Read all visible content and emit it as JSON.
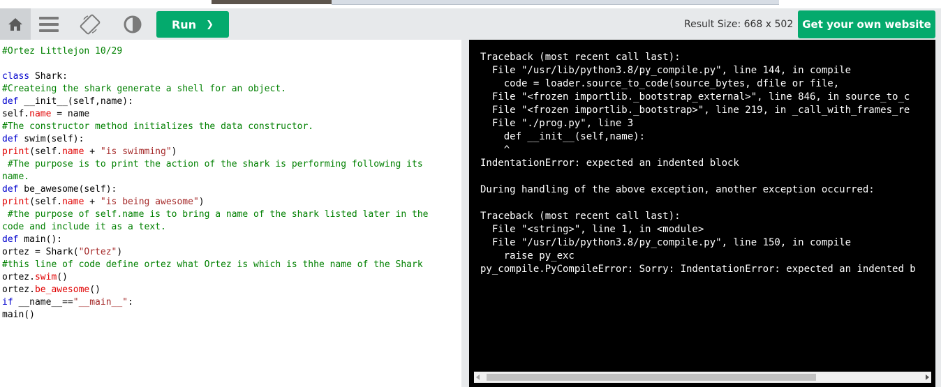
{
  "toolbar": {
    "run_label": "Run",
    "run_chevron": "❯",
    "result_size": "Result Size: 668 x 502",
    "get_site_label": "Get your own website"
  },
  "icons": [
    "home-icon",
    "menu-icon",
    "rotate-icon",
    "contrast-icon",
    "chevron-right-icon",
    "scroll-left-icon",
    "scroll-right-icon"
  ],
  "colors": {
    "accent": "#04aa6d",
    "toolbar_bg": "#e7e9eb",
    "output_bg": "#000000",
    "comment": "#008000",
    "keyword": "#0000cd",
    "attribute": "#e00000",
    "string": "#a52a2a"
  },
  "code_lines": [
    [
      {
        "t": "#Ortez Littlejon 10/29",
        "c": "comment"
      }
    ],
    [],
    [
      {
        "t": "class",
        "c": "kw"
      },
      {
        "t": " Shark:",
        "c": "plain"
      }
    ],
    [
      {
        "t": "#Createing the shark generate a shell for an object.",
        "c": "comment"
      }
    ],
    [
      {
        "t": "def",
        "c": "kw"
      },
      {
        "t": " __init__(self,name):",
        "c": "plain"
      }
    ],
    [
      {
        "t": "self.",
        "c": "plain"
      },
      {
        "t": "name",
        "c": "prop"
      },
      {
        "t": " = name",
        "c": "plain"
      }
    ],
    [
      {
        "t": "#The constructor method initializes the data constructor.",
        "c": "comment"
      }
    ],
    [
      {
        "t": "def",
        "c": "kw"
      },
      {
        "t": " swim(self):",
        "c": "plain"
      }
    ],
    [
      {
        "t": "print",
        "c": "prop"
      },
      {
        "t": "(self.",
        "c": "plain"
      },
      {
        "t": "name",
        "c": "prop"
      },
      {
        "t": " + ",
        "c": "plain"
      },
      {
        "t": "\"is swimming\"",
        "c": "str"
      },
      {
        "t": ")",
        "c": "plain"
      }
    ],
    [
      {
        "t": " #The purpose is to print the action of the shark is performing following its",
        "c": "comment"
      }
    ],
    [
      {
        "t": "name.",
        "c": "comment"
      }
    ],
    [
      {
        "t": "def",
        "c": "kw"
      },
      {
        "t": " be_awesome(self):",
        "c": "plain"
      }
    ],
    [
      {
        "t": "print",
        "c": "prop"
      },
      {
        "t": "(self.",
        "c": "plain"
      },
      {
        "t": "name",
        "c": "prop"
      },
      {
        "t": " + ",
        "c": "plain"
      },
      {
        "t": "\"is being awesome\"",
        "c": "str"
      },
      {
        "t": ")",
        "c": "plain"
      }
    ],
    [
      {
        "t": " #the purpose of self.name is to bring a name of the shark listed later in the",
        "c": "comment"
      }
    ],
    [
      {
        "t": "code and include it as a text.",
        "c": "comment"
      }
    ],
    [
      {
        "t": "def",
        "c": "kw"
      },
      {
        "t": " main():",
        "c": "plain"
      }
    ],
    [
      {
        "t": "ortez = Shark(",
        "c": "plain"
      },
      {
        "t": "\"Ortez\"",
        "c": "str"
      },
      {
        "t": ")",
        "c": "plain"
      }
    ],
    [
      {
        "t": "#this line of code define ortez what Ortez is which is thhe name of the Shark",
        "c": "comment"
      }
    ],
    [
      {
        "t": "ortez.",
        "c": "plain"
      },
      {
        "t": "swim",
        "c": "prop"
      },
      {
        "t": "()",
        "c": "plain"
      }
    ],
    [
      {
        "t": "ortez.",
        "c": "plain"
      },
      {
        "t": "be_awesome",
        "c": "prop"
      },
      {
        "t": "()",
        "c": "plain"
      }
    ],
    [
      {
        "t": "if",
        "c": "kw"
      },
      {
        "t": " __name__==",
        "c": "plain"
      },
      {
        "t": "\"__main__\"",
        "c": "str"
      },
      {
        "t": ":",
        "c": "plain"
      }
    ],
    [
      {
        "t": "main()",
        "c": "plain"
      }
    ]
  ],
  "output_lines": [
    "Traceback (most recent call last):",
    "  File \"/usr/lib/python3.8/py_compile.py\", line 144, in compile",
    "    code = loader.source_to_code(source_bytes, dfile or file,",
    "  File \"<frozen importlib._bootstrap_external>\", line 846, in source_to_c",
    "  File \"<frozen importlib._bootstrap>\", line 219, in _call_with_frames_re",
    "  File \"./prog.py\", line 3",
    "    def __init__(self,name):",
    "    ^",
    "IndentationError: expected an indented block",
    "",
    "During handling of the above exception, another exception occurred:",
    "",
    "Traceback (most recent call last):",
    "  File \"<string>\", line 1, in <module>",
    "  File \"/usr/lib/python3.8/py_compile.py\", line 150, in compile",
    "    raise py_exc",
    "py_compile.PyCompileError: Sorry: IndentationError: expected an indented b"
  ]
}
